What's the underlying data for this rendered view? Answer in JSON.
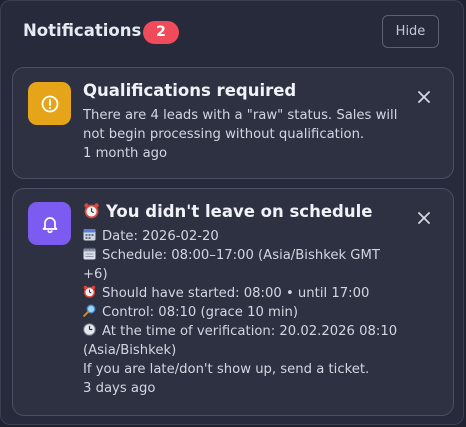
{
  "header": {
    "title": "Notifications",
    "count": "2",
    "hide_label": "Hide"
  },
  "notifications": [
    {
      "icon": "alert-circle-icon",
      "icon_bg": "#e6a419",
      "title": "Qualifications required",
      "message": "There are 4 leads with a \"raw\" status. Sales will not begin processing without qualification.",
      "time": "1 month ago"
    },
    {
      "icon": "bell-icon",
      "icon_bg": "#7c5cf0",
      "title": "You didn't leave on schedule",
      "title_emoji": "alarm-clock-icon",
      "lines": {
        "date": "Date: 2026-02-20",
        "schedule": "Schedule: 08:00–17:00 (Asia/Bishkek GMT +6)",
        "started": "Should have started: 08:00 • until 17:00",
        "control": "Control: 08:10 (grace 10 min)",
        "verification": "At the time of verification: 20.02.2026 08:10 (Asia/Bishkek)",
        "advice": "If you are late/don't show up, send a ticket."
      },
      "time": "3 days ago"
    }
  ],
  "colors": {
    "badge": "#ef4b5a",
    "panel_bg": "#262a3a",
    "card_bg": "#2d3142"
  }
}
